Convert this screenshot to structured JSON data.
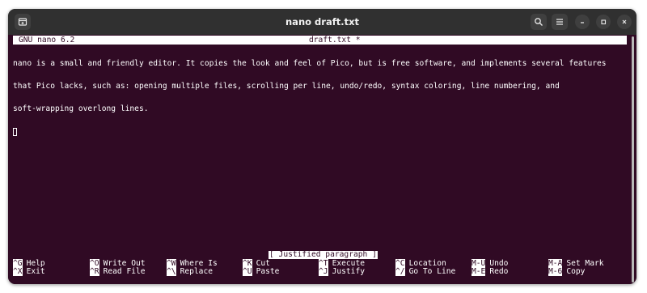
{
  "window": {
    "title": "nano draft.txt"
  },
  "nano": {
    "version": "GNU nano 6.2",
    "filename": "draft.txt *",
    "lines": [
      "nano is a small and friendly editor. It copies the look and feel of Pico, but is free software, and implements several features",
      "that Pico lacks, such as: opening multiple files, scrolling per line, undo/redo, syntax coloring, line numbering, and",
      "soft-wrapping overlong lines."
    ],
    "status_message": "[ Justified paragraph ]",
    "shortcuts": [
      {
        "key": "^G",
        "label": "Help"
      },
      {
        "key": "^X",
        "label": "Exit"
      },
      {
        "key": "^O",
        "label": "Write Out"
      },
      {
        "key": "^R",
        "label": "Read File"
      },
      {
        "key": "^W",
        "label": "Where Is"
      },
      {
        "key": "^\\",
        "label": "Replace"
      },
      {
        "key": "^K",
        "label": "Cut"
      },
      {
        "key": "^U",
        "label": "Paste"
      },
      {
        "key": "^T",
        "label": "Execute"
      },
      {
        "key": "^J",
        "label": "Justify"
      },
      {
        "key": "^C",
        "label": "Location"
      },
      {
        "key": "^/",
        "label": "Go To Line"
      },
      {
        "key": "M-U",
        "label": "Undo"
      },
      {
        "key": "M-E",
        "label": "Redo"
      },
      {
        "key": "M-A",
        "label": "Set Mark"
      },
      {
        "key": "M-6",
        "label": "Copy"
      }
    ]
  },
  "colors": {
    "terminal_bg": "#300a24",
    "terminal_fg": "#ffffff",
    "titlebar_bg": "#303030"
  },
  "icons": {
    "new_tab": "new-tab-icon",
    "search": "search-icon",
    "menu": "hamburger-menu-icon",
    "minimize": "minimize-icon",
    "maximize": "maximize-icon",
    "close": "close-icon"
  }
}
